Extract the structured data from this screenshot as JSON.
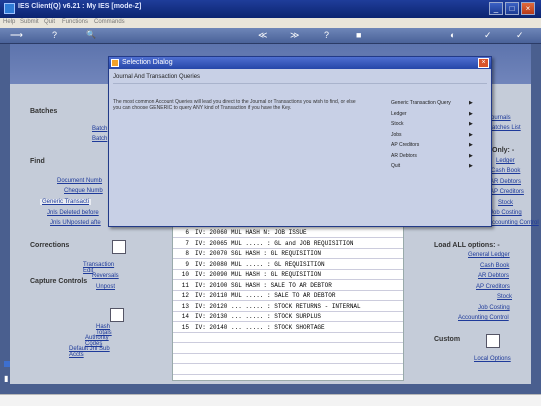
{
  "app": {
    "title": "IES Client(Q) v6.21 : My IES     [mode-Z]"
  },
  "menu": [
    "Help",
    "Submit",
    "Quit",
    "Functions",
    "Commands"
  ],
  "toolbar": [
    "⟶",
    "?",
    "🔍",
    "≫",
    "≪",
    "?",
    "■",
    "◐",
    "✓",
    "✓"
  ],
  "left": {
    "batches_header": "Batches",
    "batches_items": [
      "Batch",
      "Batch"
    ],
    "find_header": "Find",
    "find_items": [
      "Document Numb",
      "Cheque Numb",
      "Generic Transacti",
      "Jnls Deleted before",
      "Jnls UNposted afte"
    ],
    "corrections_header": "Corrections",
    "corrections_items": [
      "Transaction Edit",
      "Reversals",
      "Unpost"
    ],
    "capture_header": "Capture Controls",
    "capture_items": [
      "Hash Totals",
      "Authority Codes",
      "Default Jnl Sub Accts"
    ]
  },
  "right": {
    "top_items": [
      "Journals",
      "Batches List",
      "Only: -",
      "Ledger",
      "Cash Book",
      "AR Debtors",
      "AP Creditors",
      "Stock",
      "Job Costing",
      "Accounting Control"
    ],
    "load_header": "Load ALL options: -",
    "load_items": [
      "General Ledger",
      "Cash Book",
      "AR Debtors",
      "AP Creditors",
      "Stock",
      "Job Costing",
      "Accounting Control"
    ],
    "custom_header": "Custom",
    "custom_items": [
      "Local Options"
    ]
  },
  "grid": {
    "rows": [
      {
        "n": "6",
        "t": "IV: 20060 MUL HASH N: JOB ISSUE"
      },
      {
        "n": "7",
        "t": "IV: 20065 MUL ..... : GL and JOB REQUISITION"
      },
      {
        "n": "8",
        "t": "IV: 20070 SGL HASH : GL REQUISITION"
      },
      {
        "n": "9",
        "t": "IV: 20080 MUL ..... : GL REQUISITION"
      },
      {
        "n": "10",
        "t": "IV: 20090 MUL HASH : GL REQUISITION"
      },
      {
        "n": "11",
        "t": "IV: 20100 SGL HASH : SALE TO AR DEBTOR"
      },
      {
        "n": "12",
        "t": "IV: 20110 MUL ..... : SALE TO AR DEBTOR"
      },
      {
        "n": "13",
        "t": "IV: 20120 ... ..... : STOCK RETURNS - INTERNAL"
      },
      {
        "n": "14",
        "t": "IV: 20130 ... ..... : STOCK SURPLUS"
      },
      {
        "n": "15",
        "t": "IV: 20140 ... ..... : STOCK SHORTAGE"
      }
    ]
  },
  "dialog": {
    "title": "Selection Dialog",
    "subtitle": "Journal And Transaction Queries",
    "description": "The most common Account Queries will lead you direct to the Journal or Transactions you wish to find, or else you can choose GENERIC to query ANY kind of Transaction if you have the Key.",
    "options": [
      "Generic Transaction Query",
      "Ledger",
      "Stock",
      "Jobs",
      "AP Creditors",
      "AR Debtors",
      "Quit"
    ]
  }
}
